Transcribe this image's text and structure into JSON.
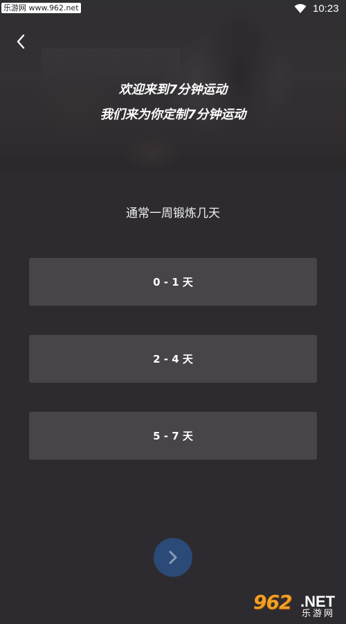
{
  "status_bar": {
    "watermark": "乐游网 www.962.net",
    "time": "10:23",
    "wifi_icon": "wifi-icon"
  },
  "header": {
    "back_icon": "chevron-left-icon",
    "title_line1": "欢迎来到7分钟运动",
    "title_line2": "我们来为你定制7分钟运动"
  },
  "question": {
    "text": "通常一周锻炼几天",
    "options": [
      {
        "label": "0 - 1 天"
      },
      {
        "label": "2 - 4 天"
      },
      {
        "label": "5 - 7 天"
      }
    ]
  },
  "footer": {
    "next_icon": "chevron-right-icon",
    "next_button_color": "#2c4a77",
    "watermark_brand": "962",
    "watermark_net": ".NET",
    "watermark_sub": "乐游网"
  },
  "colors": {
    "background": "#2e2b30",
    "option_background": "#47444a",
    "text": "#ffffff"
  }
}
